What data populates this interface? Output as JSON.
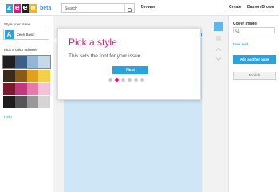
{
  "app": {
    "logo_letters": [
      "z",
      "e",
      "e",
      "n"
    ],
    "logo_colors": [
      "#2aa3de",
      "#e0157b",
      "#222222",
      "#f7b51b"
    ],
    "beta_label": "beta"
  },
  "topbar": {
    "search_placeholder": "Search",
    "search_icon": "search-icon",
    "browse_label": "Browse",
    "create_label": "Create",
    "user_name": "Damon Brown"
  },
  "left_panel": {
    "style_label": "Style your issue",
    "style_name": "Zeen Basic",
    "style_letter": "A",
    "color_scheme_label": "Pick a color scheme",
    "swatches": [
      [
        "#1f1f1f",
        "#3c5f85",
        "#91b6d6",
        "#c7d8e8"
      ],
      [
        "#3a2b18",
        "#8a5a17",
        "#e1a11b",
        "#f3d04c"
      ],
      [
        "#7a1a2e",
        "#c0397e",
        "#e67aaa",
        "#f3c2d8"
      ],
      [
        "#1d1d1d",
        "#555555",
        "#999999",
        "#d5d5d5"
      ]
    ],
    "help_label": "Help"
  },
  "modal": {
    "title": "Pick a style",
    "subtitle": "This sets the font for your issue.",
    "next_label": "Next",
    "step_count": 6,
    "active_step": 2
  },
  "right_panel": {
    "cover_label": "Cover image",
    "free_feed_label": "Free feed",
    "add_page_label": "Add another page",
    "publish_label": "Publish"
  },
  "colors": {
    "accent": "#27a3dd",
    "brand_pink": "#e0157b",
    "canvas": "#cfe6f6"
  }
}
